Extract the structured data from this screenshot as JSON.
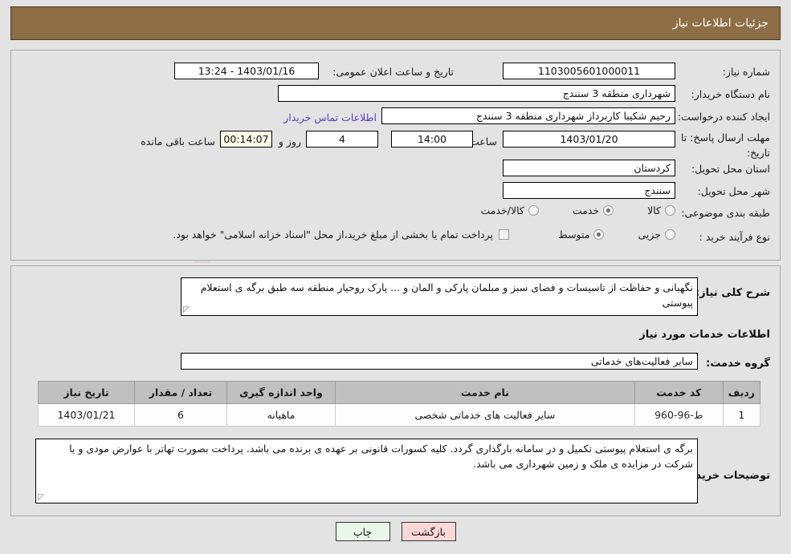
{
  "header": {
    "title": "جزئیات اطلاعات نیاز"
  },
  "top_section": {
    "need_number_label": "شماره نیاز:",
    "need_number_value": "1103005601000011",
    "public_announce_label": "تاریخ و ساعت اعلان عمومی:",
    "public_announce_value": "1403/01/16 - 13:24",
    "buyer_org_label": "نام دستگاه خریدار:",
    "buyer_org_value": "شهرداری منطقه 3 سنندج",
    "creator_label": "ایجاد کننده درخواست:",
    "creator_value": "رحیم شکیبا کاربرداز شهرداری منطقه 3 سنندج",
    "buyer_contact_link": "اطلاعات تماس خریدار",
    "deadline_label": "مهلت ارسال پاسخ: تا تاریخ:",
    "deadline_date": "1403/01/20",
    "hour_label": "ساعت",
    "hour_value": "14:00",
    "days_value": "4",
    "days_and_label": "روز و",
    "countdown_value": "00:14:07",
    "remaining_label": "ساعت باقی مانده",
    "province_label": "استان محل تحویل:",
    "province_value": "کردستان",
    "city_label": "شهر محل تحویل:",
    "city_value": "سنندج",
    "category_label": "طبقه بندی موضوعی:",
    "category_options": [
      {
        "label": "کالا",
        "selected": false
      },
      {
        "label": "خدمت",
        "selected": true
      },
      {
        "label": "کالا/خدمت",
        "selected": false
      }
    ],
    "process_label": "نوع فرآیند خرید :",
    "process_options": [
      {
        "label": "جزیی",
        "selected": false
      },
      {
        "label": "متوسط",
        "selected": true
      }
    ],
    "treasury_checkbox_checked": false,
    "treasury_text": "پرداخت تمام یا بخشی از مبلغ خرید،از محل \"اسناد خزانه اسلامی\" خواهد بود."
  },
  "bottom_section": {
    "description_label": "شرح کلی نیاز:",
    "description_value": "نگهبانی و حفاظت از تاسیسات و فضای سبز و مبلمان پارکی و المان و ... پارک روحیار منطقه سه طبق برگه ی استعلام پیوستی",
    "services_info_title": "اطلاعات خدمات مورد نیاز",
    "service_group_label": "گروه خدمت:",
    "service_group_value": "سایر فعالیت‌های خدماتی",
    "buyer_notes_label": "توضیحات خریدار:",
    "buyer_notes_value": "برگه ی استعلام پیوستی تکمیل و در سامانه بارگذاری گردد. کلیه کسورات قانونی بر عهده ی برنده می باشد. پرداخت بصورت تهاتر با عوارض مودی و یا شرکت در مزایده ی ملک و زمین شهرداری می باشد."
  },
  "table": {
    "headers": [
      "ردیف",
      "کد خدمت",
      "نام خدمت",
      "واحد اندازه گیری",
      "تعداد / مقدار",
      "تاریخ نیاز"
    ],
    "rows": [
      {
        "radif": "1",
        "code": "ط-96-960",
        "name": "سایر فعالیت های خدماتی شخصی",
        "unit": "ماهیانه",
        "qty": "6",
        "date": "1403/01/21"
      }
    ]
  },
  "footer": {
    "print_label": "چاپ",
    "back_label": "بازگشت"
  },
  "watermark": {
    "text": "AriaTender.net"
  },
  "colors": {
    "header_bg": "#8d6e45",
    "panel_bg": "#e3e3e3",
    "link": "#5a3fc0",
    "countdown_bg": "#fbfbe8",
    "print_btn": "#e9f7e9",
    "back_btn": "#fbd7d7"
  }
}
